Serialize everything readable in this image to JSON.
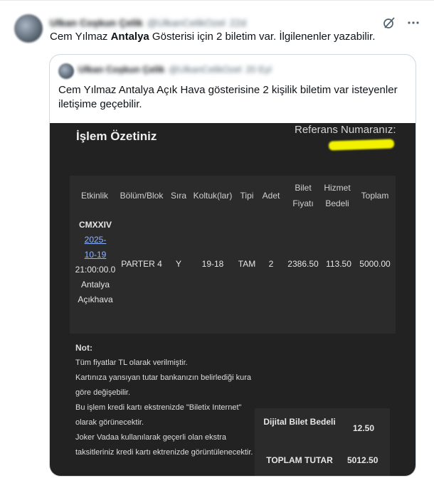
{
  "post": {
    "author_name": "Ulkan Coşkun Çelik",
    "author_handle": "@UlkanCelikOzel",
    "time": "22d",
    "text_prefix": "Cem Yılmaz ",
    "text_bold": "Antalya",
    "text_suffix": " Gösterisi için 2 biletim var. İlgilenenler yazabilir."
  },
  "quote": {
    "author_name": "Ulkan Coşkun Çelik",
    "author_handle": "@UlkanCelikOzel",
    "time": "20 Eyl",
    "text": "Cem Yılmaz Antalya Açık Hava gösterisine 2 kişilik biletim var isteyenler iletişime geçebilir."
  },
  "receipt": {
    "title": "İşlem Özetiniz",
    "reference_label": "Referans Numaranız:",
    "columns": [
      "Etkinlik",
      "Bölüm/Blok",
      "Sıra",
      "Koltuk(lar)",
      "Tipi",
      "Adet",
      "Bilet Fiyatı",
      "Hizmet Bedeli",
      "Toplam"
    ],
    "event": {
      "code": "CMXXIV",
      "date": "2025-10-19",
      "time": "21:00:00.0",
      "venue": "Antalya Açıkhava"
    },
    "row": {
      "section": "PARTER 4",
      "row": "Y",
      "seats": "19-18",
      "type": "TAM",
      "count": "2",
      "ticket_price": "2386.50",
      "service_fee": "113.50",
      "total": "5000.00"
    },
    "note_title": "Not:",
    "notes": [
      "Tüm fiyatlar TL olarak verilmiştir.",
      "Kartınıza yansıyan tutar bankanızın belirlediği kura göre değişebilir.",
      "Bu işlem kredi kartı ekstrenizde \"Biletix Internet\" olarak görünecektir.",
      "Joker Vadaa kullanılarak geçerli olan ekstra taksitleriniz kredi kartı ektrenizde görüntülenecektir."
    ],
    "digital_fee_label": "Dijital Bilet Bedeli",
    "digital_fee_value": "12.50",
    "grand_total_label": "TOPLAM TUTAR",
    "grand_total_value": "5012.50"
  }
}
